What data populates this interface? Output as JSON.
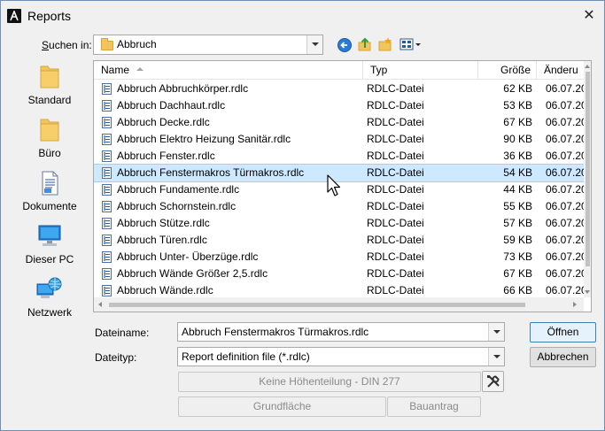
{
  "window": {
    "title": "Reports",
    "close_glyph": "✕"
  },
  "lookin": {
    "label_prefix": "S",
    "label_rest": "uchen in:",
    "value": "Abbruch"
  },
  "toolbar": {
    "icons": [
      "back-icon",
      "up-folder-icon",
      "new-folder-icon",
      "view-menu-icon"
    ]
  },
  "places": [
    {
      "label": "Standard",
      "icon": "folder-icon"
    },
    {
      "label": "Büro",
      "icon": "folder-icon"
    },
    {
      "label": "Dokumente",
      "icon": "document-icon"
    },
    {
      "label": "Dieser PC",
      "icon": "computer-icon"
    },
    {
      "label": "Netzwerk",
      "icon": "network-icon"
    }
  ],
  "columns": {
    "name": "Name",
    "type": "Typ",
    "size": "Größe",
    "date": "Änderu"
  },
  "files": [
    {
      "name": "Abbruch Abbruchkörper.rdlc",
      "type": "RDLC-Datei",
      "size": "62 KB",
      "date": "06.07.20"
    },
    {
      "name": "Abbruch Dachhaut.rdlc",
      "type": "RDLC-Datei",
      "size": "53 KB",
      "date": "06.07.20"
    },
    {
      "name": "Abbruch Decke.rdlc",
      "type": "RDLC-Datei",
      "size": "67 KB",
      "date": "06.07.20"
    },
    {
      "name": "Abbruch Elektro Heizung Sanitär.rdlc",
      "type": "RDLC-Datei",
      "size": "90 KB",
      "date": "06.07.20"
    },
    {
      "name": "Abbruch Fenster.rdlc",
      "type": "RDLC-Datei",
      "size": "36 KB",
      "date": "06.07.20"
    },
    {
      "name": "Abbruch Fenstermakros Türmakros.rdlc",
      "type": "RDLC-Datei",
      "size": "54 KB",
      "date": "06.07.20",
      "selected": true
    },
    {
      "name": "Abbruch Fundamente.rdlc",
      "type": "RDLC-Datei",
      "size": "44 KB",
      "date": "06.07.20"
    },
    {
      "name": "Abbruch Schornstein.rdlc",
      "type": "RDLC-Datei",
      "size": "55 KB",
      "date": "06.07.20"
    },
    {
      "name": "Abbruch Stütze.rdlc",
      "type": "RDLC-Datei",
      "size": "57 KB",
      "date": "06.07.20"
    },
    {
      "name": "Abbruch Türen.rdlc",
      "type": "RDLC-Datei",
      "size": "59 KB",
      "date": "06.07.20"
    },
    {
      "name": "Abbruch Unter- Überzüge.rdlc",
      "type": "RDLC-Datei",
      "size": "73 KB",
      "date": "06.07.20"
    },
    {
      "name": "Abbruch Wände Größer 2,5.rdlc",
      "type": "RDLC-Datei",
      "size": "67 KB",
      "date": "06.07.20"
    },
    {
      "name": "Abbruch Wände.rdlc",
      "type": "RDLC-Datei",
      "size": "66 KB",
      "date": "06.07.20"
    }
  ],
  "filename": {
    "label": "Dateiname:",
    "value": "Abbruch Fenstermakros Türmakros.rdlc"
  },
  "filetype": {
    "label": "Dateityp:",
    "value": "Report definition file (*.rdlc)"
  },
  "buttons": {
    "open": "Öffnen",
    "cancel": "Abbrechen",
    "height_division": "Keine Höhenteilung - DIN 277",
    "floor_area": "Grundfläche",
    "building_application": "Bauantrag"
  },
  "colors": {
    "selection": "#cde8ff",
    "selection_border": "#99d1ff",
    "primary_button_border": "#3c7fb1"
  }
}
